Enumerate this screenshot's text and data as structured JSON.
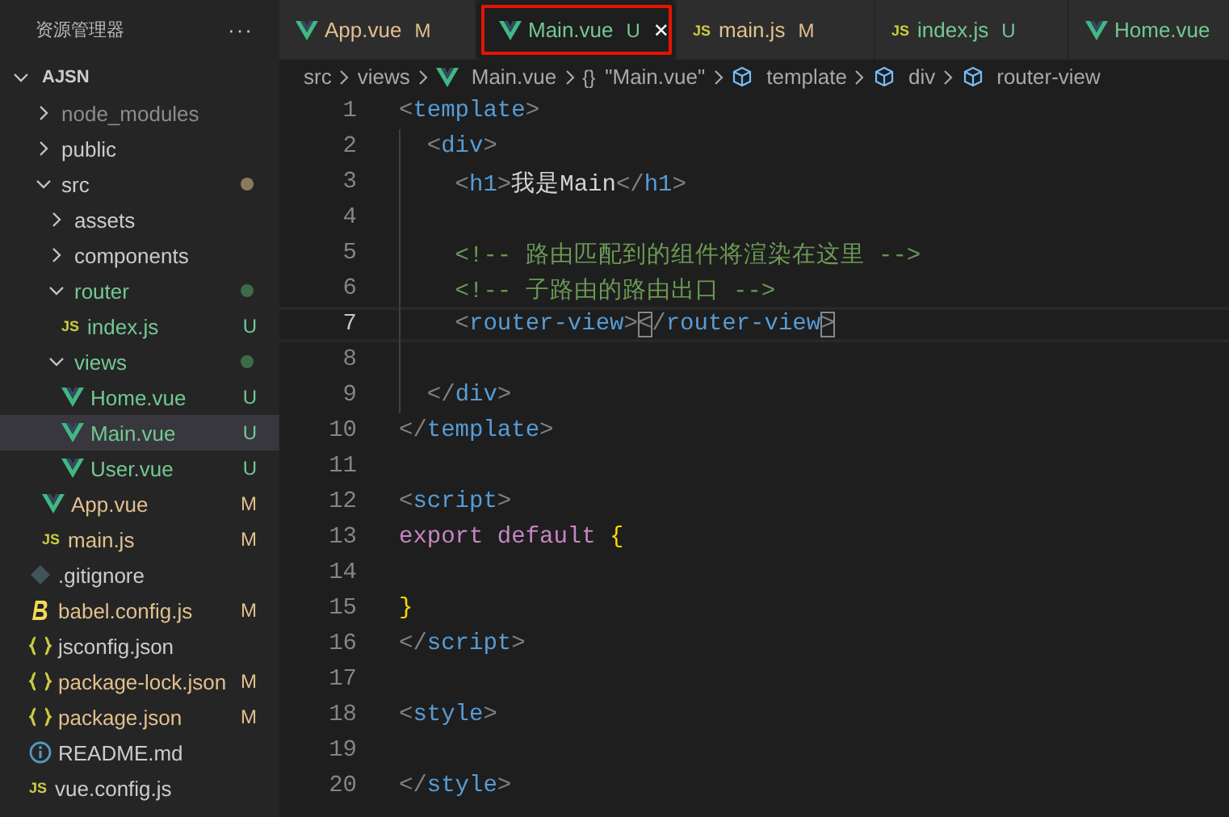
{
  "sidebar": {
    "title": "资源管理器",
    "more": "···",
    "root": {
      "label": "AJSN",
      "expanded": true
    },
    "items": [
      {
        "label": "node_modules",
        "kind": "folder",
        "expanded": false,
        "color": "#8c8c8c",
        "selected": false
      },
      {
        "label": "public",
        "kind": "folder",
        "expanded": false,
        "color": "#cccccc",
        "selected": false
      },
      {
        "label": "src",
        "kind": "folder",
        "expanded": true,
        "color": "#cccccc",
        "dot": {
          "color": "#8a7a5c"
        },
        "selected": false,
        "children": [
          {
            "label": "assets",
            "kind": "folder",
            "expanded": false,
            "color": "#cccccc",
            "selected": false
          },
          {
            "label": "components",
            "kind": "folder",
            "expanded": false,
            "color": "#cccccc",
            "selected": false
          },
          {
            "label": "router",
            "kind": "folder",
            "expanded": true,
            "color": "#73c991",
            "dot": {
              "color": "#3d6b4a"
            },
            "selected": false,
            "children": [
              {
                "label": "index.js",
                "kind": "js",
                "icon": "JS",
                "color": "#73c991",
                "badge": "U",
                "selected": false
              }
            ]
          },
          {
            "label": "views",
            "kind": "folder",
            "expanded": true,
            "color": "#73c991",
            "dot": {
              "color": "#3d6b4a"
            },
            "selected": false,
            "children": [
              {
                "label": "Home.vue",
                "kind": "vue",
                "color": "#73c991",
                "badge": "U",
                "selected": false
              },
              {
                "label": "Main.vue",
                "kind": "vue",
                "color": "#73c991",
                "badge": "U",
                "selected": true
              },
              {
                "label": "User.vue",
                "kind": "vue",
                "color": "#73c991",
                "badge": "U",
                "selected": false
              }
            ]
          },
          {
            "label": "App.vue",
            "kind": "vue",
            "color": "#e2c08d",
            "badge": "M",
            "selected": false
          },
          {
            "label": "main.js",
            "kind": "js",
            "icon": "JS",
            "color": "#e2c08d",
            "badge": "M",
            "selected": false
          }
        ]
      },
      {
        "label": ".gitignore",
        "kind": "git",
        "color": "#cccccc",
        "selected": false
      },
      {
        "label": "babel.config.js",
        "kind": "babel",
        "color": "#e2c08d",
        "badge": "M",
        "selected": false
      },
      {
        "label": "jsconfig.json",
        "kind": "json",
        "color": "#cccccc",
        "selected": false
      },
      {
        "label": "package-lock.json",
        "kind": "json",
        "color": "#e2c08d",
        "badge": "M",
        "selected": false
      },
      {
        "label": "package.json",
        "kind": "json",
        "color": "#e2c08d",
        "badge": "M",
        "selected": false
      },
      {
        "label": "README.md",
        "kind": "info",
        "color": "#cccccc",
        "selected": false
      },
      {
        "label": "vue.config.js",
        "kind": "js",
        "icon": "JS",
        "color": "#cccccc",
        "selected": false
      }
    ]
  },
  "tabs": [
    {
      "label": "App.vue",
      "kind": "vue",
      "color": "#e2c08d",
      "badge": "M",
      "selected": false,
      "outlined": false
    },
    {
      "label": "Main.vue",
      "kind": "vue",
      "color": "#73c991",
      "badge": "U",
      "selected": true,
      "outlined": true,
      "close": "✕"
    },
    {
      "label": "main.js",
      "kind": "js",
      "icon": "JS",
      "color": "#e2c08d",
      "badge": "M",
      "selected": false,
      "outlined": false
    },
    {
      "label": "index.js",
      "kind": "js",
      "icon": "JS",
      "color": "#73c991",
      "badge": "U",
      "selected": false,
      "outlined": false
    },
    {
      "label": "Home.vue",
      "kind": "vue",
      "color": "#73c991",
      "selected": false,
      "outlined": false
    }
  ],
  "breadcrumb": [
    {
      "label": "src",
      "kind": "plain"
    },
    {
      "label": "views",
      "kind": "plain"
    },
    {
      "label": "Main.vue",
      "kind": "vue"
    },
    {
      "label": "\"Main.vue\"",
      "kind": "object",
      "icon": "{}"
    },
    {
      "label": "template",
      "kind": "element"
    },
    {
      "label": "div",
      "kind": "element"
    },
    {
      "label": "router-view",
      "kind": "element"
    }
  ],
  "code": [
    {
      "number": "1",
      "current": false,
      "guide": false,
      "tokens": [
        {
          "t": "<",
          "kind": "punct"
        },
        {
          "t": "template",
          "kind": "tag"
        },
        {
          "t": ">",
          "kind": "punct"
        }
      ]
    },
    {
      "number": "2",
      "current": false,
      "guide": true,
      "tokens": [
        {
          "t": "  <",
          "kind": "punct"
        },
        {
          "t": "div",
          "kind": "tag"
        },
        {
          "t": ">",
          "kind": "punct"
        }
      ]
    },
    {
      "number": "3",
      "current": false,
      "guide": true,
      "tokens": [
        {
          "t": "    <",
          "kind": "punct"
        },
        {
          "t": "h1",
          "kind": "tag"
        },
        {
          "t": ">",
          "kind": "punct"
        },
        {
          "t": "我是Main",
          "kind": "text"
        },
        {
          "t": "</",
          "kind": "punct"
        },
        {
          "t": "h1",
          "kind": "tag"
        },
        {
          "t": ">",
          "kind": "punct"
        }
      ]
    },
    {
      "number": "4",
      "current": false,
      "guide": true
    },
    {
      "number": "5",
      "current": false,
      "guide": true,
      "tokens": [
        {
          "t": "    <!-- 路由匹配到的组件将渲染在这里 -->",
          "kind": "comment"
        }
      ]
    },
    {
      "number": "6",
      "current": false,
      "guide": true,
      "tokens": [
        {
          "t": "    <!-- 子路由的路由出口 -->",
          "kind": "comment"
        }
      ]
    },
    {
      "number": "7",
      "current": true,
      "guide": true,
      "tokens": [
        {
          "t": "    <",
          "kind": "punct"
        },
        {
          "t": "router-view",
          "kind": "tag"
        },
        {
          "t": ">",
          "kind": "punct"
        },
        {
          "t": "<",
          "kind": "match"
        },
        {
          "t": "/",
          "kind": "punct"
        },
        {
          "t": "router-view",
          "kind": "tag"
        },
        {
          "t": ">",
          "kind": "match"
        }
      ]
    },
    {
      "number": "8",
      "current": false,
      "guide": true
    },
    {
      "number": "9",
      "current": false,
      "guide": true,
      "tokens": [
        {
          "t": "  </",
          "kind": "punct"
        },
        {
          "t": "div",
          "kind": "tag"
        },
        {
          "t": ">",
          "kind": "punct"
        }
      ]
    },
    {
      "number": "10",
      "current": false,
      "guide": false,
      "tokens": [
        {
          "t": "</",
          "kind": "punct"
        },
        {
          "t": "template",
          "kind": "tag"
        },
        {
          "t": ">",
          "kind": "punct"
        }
      ]
    },
    {
      "number": "11",
      "current": false,
      "guide": false
    },
    {
      "number": "12",
      "current": false,
      "guide": false,
      "tokens": [
        {
          "t": "<",
          "kind": "punct"
        },
        {
          "t": "script",
          "kind": "tag"
        },
        {
          "t": ">",
          "kind": "punct"
        }
      ]
    },
    {
      "number": "13",
      "current": false,
      "guide": false,
      "tokens": [
        {
          "t": "export default ",
          "kind": "keyword"
        },
        {
          "t": "{",
          "kind": "brace"
        }
      ]
    },
    {
      "number": "14",
      "current": false,
      "guide": false
    },
    {
      "number": "15",
      "current": false,
      "guide": false,
      "tokens": [
        {
          "t": "}",
          "kind": "brace"
        }
      ]
    },
    {
      "number": "16",
      "current": false,
      "guide": false,
      "tokens": [
        {
          "t": "</",
          "kind": "punct"
        },
        {
          "t": "script",
          "kind": "tag"
        },
        {
          "t": ">",
          "kind": "punct"
        }
      ]
    },
    {
      "number": "17",
      "current": false,
      "guide": false
    },
    {
      "number": "18",
      "current": false,
      "guide": false,
      "tokens": [
        {
          "t": "<",
          "kind": "punct"
        },
        {
          "t": "style",
          "kind": "tag"
        },
        {
          "t": ">",
          "kind": "punct"
        }
      ]
    },
    {
      "number": "19",
      "current": false,
      "guide": false
    },
    {
      "number": "20",
      "current": false,
      "guide": false,
      "tokens": [
        {
          "t": "</",
          "kind": "punct"
        },
        {
          "t": "style",
          "kind": "tag"
        },
        {
          "t": ">",
          "kind": "punct"
        }
      ]
    }
  ]
}
